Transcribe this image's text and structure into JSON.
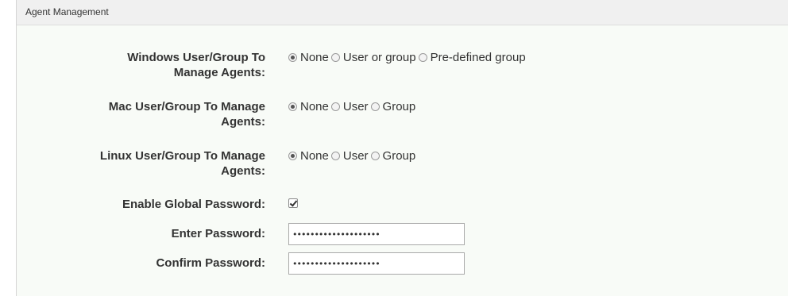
{
  "panel": {
    "title": "Agent Management"
  },
  "fields": {
    "windows": {
      "label_line1": "Windows User/Group To",
      "label_line2": "Manage Agents:",
      "options": [
        "None",
        "User or group",
        "Pre-defined group"
      ],
      "selected": "None"
    },
    "mac": {
      "label_line1": "Mac User/Group To Manage",
      "label_line2": "Agents:",
      "options": [
        "None",
        "User",
        "Group"
      ],
      "selected": "None"
    },
    "linux": {
      "label_line1": "Linux User/Group To Manage",
      "label_line2": "Agents:",
      "options": [
        "None",
        "User",
        "Group"
      ],
      "selected": "None"
    },
    "global_password": {
      "label": "Enable Global Password:",
      "checked": true
    },
    "enter_password": {
      "label": "Enter Password:",
      "value": "••••••••••••••••••••"
    },
    "confirm_password": {
      "label": "Confirm Password:",
      "value": "••••••••••••••••••••"
    }
  }
}
